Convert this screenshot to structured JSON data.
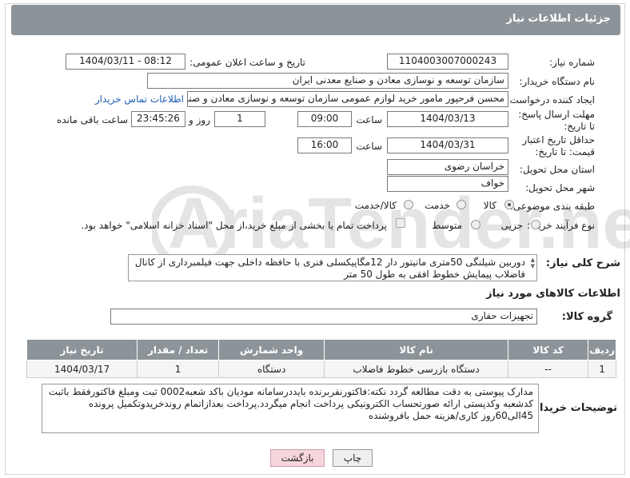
{
  "header": {
    "title": "جزئیات اطلاعات نیاز"
  },
  "fields": {
    "need_number_label": "شماره نیاز:",
    "need_number": "1104003007000243",
    "announce_label": "تاریخ و ساعت اعلان عمومی:",
    "announce_value": "1404/03/11 - 08:12",
    "buyer_org_label": "نام دستگاه خریدار:",
    "buyer_org": "سازمان توسعه و نوسازی معادن و صنایع معدنی ایران",
    "creator_label": "ایجاد کننده درخواست:",
    "creator": "محسن فرحپور مامور خرید لوازم عمومی سازمان توسعه و نوسازی معادن و صنایع",
    "contact_link": "اطلاعات تماس خریدار",
    "deadline_label": "مهلت ارسال پاسخ: تا تاریخ:",
    "deadline_date": "1404/03/13",
    "time_word": "ساعت",
    "deadline_time": "09:00",
    "days_value": "1",
    "days_word": "روز و",
    "remaining_time": "23:45:26",
    "remaining_word": "ساعت باقی مانده",
    "validity_label": "حداقل تاریخ اعتبار قیمت: تا تاریخ:",
    "validity_date": "1404/03/31",
    "validity_time": "16:00",
    "province_label": "استان محل تحویل:",
    "province": "خراسان رضوی",
    "city_label": "شهر محل تحویل:",
    "city": "خواف",
    "category_label": "طبقه بندی موضوعی:",
    "category_options": [
      "کالا",
      "خدمت",
      "کالا/خدمت"
    ],
    "category_selected": "کالا",
    "process_label": "نوع فرآیند خرید :",
    "process_options": [
      "جزیی",
      "متوسط"
    ],
    "process_note": "پرداخت تمام یا بخشی از مبلغ خرید،از محل \"اسناد خزانه اسلامی\" خواهد بود."
  },
  "description": {
    "label": "شرح کلی نیاز:",
    "text": "دوربین شیلنگی 50متری مانیتور دار 12مگاپیکسلی فنری با حافظه داخلی جهت فیلمبرداری از کانال فاضلاب پیمایش خطوط افقی به طول 50 متر"
  },
  "goods": {
    "section_title": "اطلاعات کالاهای مورد نیاز",
    "group_label": "گروه کالا:",
    "group_value": "تجهیزات حفاری",
    "columns": [
      "ردیف",
      "کد کالا",
      "نام کالا",
      "واحد شمارش",
      "تعداد / مقدار",
      "تاریخ نیاز"
    ],
    "rows": [
      [
        "1",
        "--",
        "دستگاه بازرسی خطوط فاضلاب",
        "دستگاه",
        "1",
        "1404/03/17"
      ]
    ]
  },
  "notes": {
    "label": "توضیحات خریدار:",
    "text": "مدارک پیوستی به دقت مطالعه گردد نکته:فاکتورنفربرنده بایددرسامانه مودیان باکد شعبه0002 ثبت ومبلغ فاکتورفقط باثبت کدشعبه وکدپستی ارائه صورتحساب الکترونیکی پرداخت انجام میگردد.پرداخت بعدازاتمام روندخریدوتکمیل پرونده 45الی60روز کاری/هزینه حمل بافروشنده"
  },
  "buttons": {
    "print": "چاپ",
    "back": "بازگشت"
  },
  "colors": {
    "header": "#8d9499",
    "link": "#1a5fb4",
    "back_button": "#f6d6dc"
  }
}
